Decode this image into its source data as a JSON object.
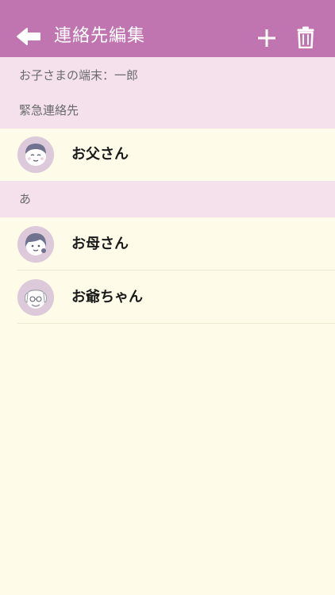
{
  "header": {
    "title": "連絡先編集",
    "background": "#c074b0",
    "back_icon": "arrow-left-icon",
    "add_icon": "plus-icon",
    "delete_icon": "trash-icon"
  },
  "device_info": {
    "label": "お子さまの端末：一郎"
  },
  "sections": [
    {
      "label": "緊急連絡先",
      "contacts": [
        {
          "name": "お父さん",
          "avatar_icon": "father-avatar-icon"
        }
      ]
    },
    {
      "label": "あ",
      "contacts": [
        {
          "name": "お母さん",
          "avatar_icon": "mother-avatar-icon"
        },
        {
          "name": "お爺ちゃん",
          "avatar_icon": "grandfather-avatar-icon"
        }
      ]
    }
  ],
  "colors": {
    "section_background": "#f4e1ec",
    "list_background": "#fefce9",
    "avatar_background": "#dcc9da"
  }
}
